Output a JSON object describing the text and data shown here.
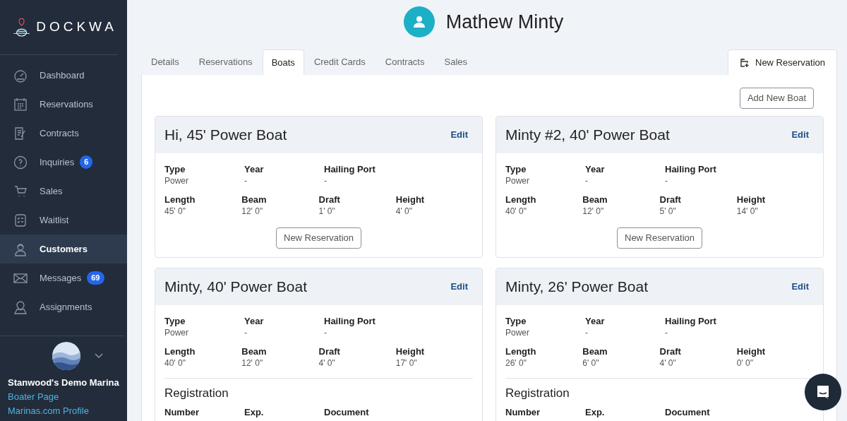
{
  "sidebar": {
    "logo": "DOCKWA",
    "items": [
      {
        "label": "Dashboard",
        "selected": false
      },
      {
        "label": "Reservations",
        "selected": false
      },
      {
        "label": "Contracts",
        "selected": false
      },
      {
        "label": "Inquiries",
        "selected": false,
        "badge": "6"
      },
      {
        "label": "Sales",
        "selected": false
      },
      {
        "label": "Waitlist",
        "selected": false
      },
      {
        "label": "Customers",
        "selected": true
      },
      {
        "label": "Messages",
        "selected": false,
        "badge": "69"
      },
      {
        "label": "Assignments",
        "selected": false
      }
    ],
    "marina": {
      "name": "Stanwood's Demo Marina",
      "links": [
        "Boater Page",
        "Marinas.com Profile"
      ]
    }
  },
  "customer": {
    "name": "Mathew Minty"
  },
  "tabs": [
    {
      "label": "Details",
      "selected": false
    },
    {
      "label": "Reservations",
      "selected": false
    },
    {
      "label": "Boats",
      "selected": true
    },
    {
      "label": "Credit Cards",
      "selected": false
    },
    {
      "label": "Contracts",
      "selected": false
    },
    {
      "label": "Sales",
      "selected": false
    }
  ],
  "new_reservation_tab": "New Reservation",
  "add_button": "Add New Boat",
  "boats": [
    {
      "title": "Hi, 45' Power Boat",
      "edit": "Edit",
      "fields": [
        [
          [
            "Type",
            "Power"
          ],
          [
            "Year",
            "-"
          ],
          [
            "Hailing Port",
            "-"
          ]
        ],
        [
          [
            "Length",
            "45' 0\""
          ],
          [
            "Beam",
            "12' 0\""
          ],
          [
            "Draft",
            "1' 0\""
          ],
          [
            "Height",
            "4' 0\""
          ]
        ]
      ],
      "button": "New Reservation"
    },
    {
      "title": "Minty #2, 40' Power Boat",
      "edit": "Edit",
      "fields": [
        [
          [
            "Type",
            "Power"
          ],
          [
            "Year",
            "-"
          ],
          [
            "Hailing Port",
            "-"
          ]
        ],
        [
          [
            "Length",
            "40' 0\""
          ],
          [
            "Beam",
            "12' 0\""
          ],
          [
            "Draft",
            "5' 0\""
          ],
          [
            "Height",
            "14' 0\""
          ]
        ]
      ],
      "button": "New Reservation"
    },
    {
      "title": "Minty, 40' Power Boat",
      "edit": "Edit",
      "fields": [
        [
          [
            "Type",
            "Power"
          ],
          [
            "Year",
            "-"
          ],
          [
            "Hailing Port",
            "-"
          ]
        ],
        [
          [
            "Length",
            "40' 0\""
          ],
          [
            "Beam",
            "12' 0\""
          ],
          [
            "Draft",
            "4' 0\""
          ],
          [
            "Height",
            "17' 0\""
          ]
        ]
      ],
      "registration": {
        "heading": "Registration",
        "columns": [
          "Number",
          "Exp.",
          "Document"
        ]
      }
    },
    {
      "title": "Minty, 26' Power Boat",
      "edit": "Edit",
      "fields": [
        [
          [
            "Type",
            "Power"
          ],
          [
            "Year",
            "-"
          ],
          [
            "Hailing Port",
            "-"
          ]
        ],
        [
          [
            "Length",
            "26' 0\""
          ],
          [
            "Beam",
            "6' 0\""
          ],
          [
            "Draft",
            "4' 0\""
          ],
          [
            "Height",
            "0' 0\""
          ]
        ]
      ],
      "registration": {
        "heading": "Registration",
        "columns": [
          "Number",
          "Exp.",
          "Document"
        ]
      }
    }
  ]
}
